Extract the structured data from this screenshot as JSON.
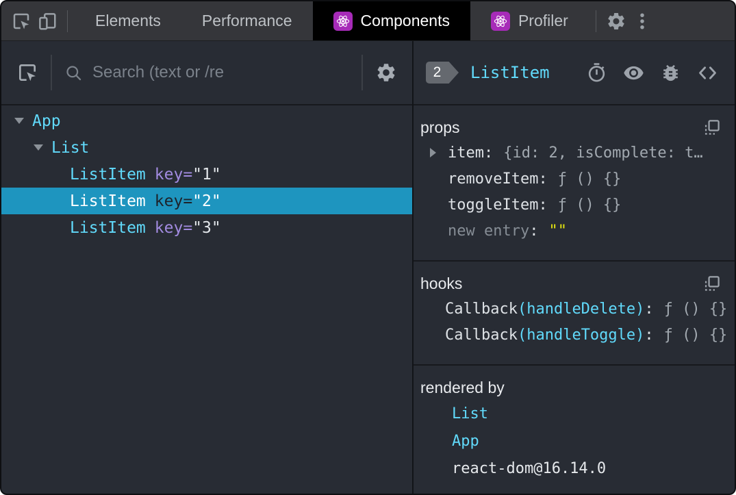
{
  "colors": {
    "toolbar_bg": "#35363a",
    "active_tab_bg": "#000000",
    "panel_bg": "#282c34",
    "selection_blue": "#1e95bf",
    "component_cyan": "#61dafb",
    "key_purple": "#a28be0",
    "react_badge_purple": "#a72bb8",
    "string_yellow": "#e5e510",
    "value_gray": "#a2a9b0"
  },
  "icons": {
    "top_left": [
      "inspect-icon",
      "device-toolbar-icon"
    ],
    "top_right": [
      "gear-icon",
      "more-vertical-icon"
    ],
    "left_panel": [
      "picker-icon",
      "search-icon",
      "gear-icon"
    ],
    "right_header": [
      "stopwatch-icon",
      "eye-icon",
      "bug-icon",
      "code-brackets-icon"
    ],
    "sections": [
      "copy-icon"
    ]
  },
  "toolbar": {
    "tabs": [
      {
        "label": "Elements"
      },
      {
        "label": "Performance"
      },
      {
        "label": "Components",
        "active": true
      },
      {
        "label": "Profiler"
      }
    ]
  },
  "left": {
    "search_placeholder": "Search (text or /re",
    "tree": {
      "items": [
        {
          "name": "App",
          "depth": 0,
          "expanded": true
        },
        {
          "name": "List",
          "depth": 1,
          "expanded": true
        },
        {
          "name": "ListItem",
          "depth": 2,
          "attr": "key=",
          "value": "\"1\""
        },
        {
          "name": "ListItem",
          "depth": 2,
          "attr": "key=",
          "value": "\"2\"",
          "selected": true
        },
        {
          "name": "ListItem",
          "depth": 2,
          "attr": "key=",
          "value": "\"3\""
        }
      ]
    }
  },
  "right": {
    "header": {
      "badge": "2",
      "component": "ListItem"
    },
    "props": {
      "title": "props",
      "rows": [
        {
          "name": "item",
          "sep": ":",
          "value": "{id: 2, isComplete: t…",
          "expandable": true
        },
        {
          "name": "removeItem",
          "sep": ":",
          "value": "ƒ () {}"
        },
        {
          "name": "toggleItem",
          "sep": ":",
          "value": "ƒ () {}"
        },
        {
          "name": "new entry",
          "sep": ":",
          "value": "\"\"",
          "muted": true,
          "value_color": "yellow"
        }
      ]
    },
    "hooks": {
      "title": "hooks",
      "rows": [
        {
          "name": "Callback",
          "param": "(handleDelete)",
          "sep": ":",
          "value": "ƒ () {}"
        },
        {
          "name": "Callback",
          "param": "(handleToggle)",
          "sep": ":",
          "value": "ƒ () {}"
        }
      ]
    },
    "rendered_by": {
      "title": "rendered by",
      "items": [
        {
          "label": "List",
          "link": true
        },
        {
          "label": "App",
          "link": true
        },
        {
          "label": "react-dom@16.14.0",
          "link": false
        }
      ]
    }
  }
}
